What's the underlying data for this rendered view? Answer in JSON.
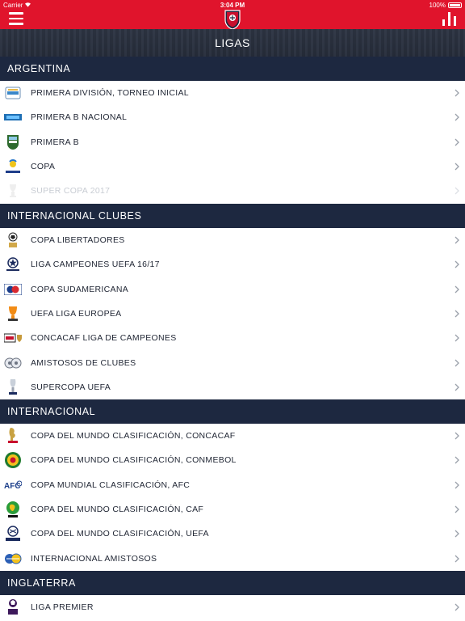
{
  "status_bar": {
    "carrier": "Carrier",
    "time": "3:04 PM",
    "battery": "100%"
  },
  "header": {
    "title": "LIGAS"
  },
  "sections": [
    {
      "title": "ARGENTINA",
      "items": [
        {
          "label": "PRIMERA DIVISIÓN, TORNEO INICIAL",
          "icon": "primera-division-logo-icon",
          "enabled": true
        },
        {
          "label": "PRIMERA B NACIONAL",
          "icon": "primera-b-nacional-logo-icon",
          "enabled": true
        },
        {
          "label": "PRIMERA B",
          "icon": "afa-crest-icon",
          "enabled": true
        },
        {
          "label": "COPA",
          "icon": "copa-argentina-logo-icon",
          "enabled": true
        },
        {
          "label": "SUPER COPA 2017",
          "icon": "super-copa-logo-icon",
          "enabled": false
        }
      ]
    },
    {
      "title": "INTERNACIONAL CLUBES",
      "items": [
        {
          "label": "COPA LIBERTADORES",
          "icon": "copa-libertadores-logo-icon",
          "enabled": true
        },
        {
          "label": "LIGA CAMPEONES UEFA 16/17",
          "icon": "champions-league-logo-icon",
          "enabled": true
        },
        {
          "label": "COPA SUDAMERICANA",
          "icon": "copa-sudamericana-logo-icon",
          "enabled": true
        },
        {
          "label": "UEFA LIGA EUROPEA",
          "icon": "europa-league-logo-icon",
          "enabled": true
        },
        {
          "label": "CONCACAF LIGA DE CAMPEONES",
          "icon": "concacaf-champions-logo-icon",
          "enabled": true
        },
        {
          "label": "AMISTOSOS DE CLUBES",
          "icon": "club-friendlies-logo-icon",
          "enabled": true
        },
        {
          "label": "SUPERCOPA UEFA",
          "icon": "uefa-supercup-logo-icon",
          "enabled": true
        }
      ]
    },
    {
      "title": "INTERNACIONAL",
      "items": [
        {
          "label": "COPA DEL MUNDO CLASIFICACIÓN, CONCACAF",
          "icon": "world-cup-logo-icon",
          "enabled": true
        },
        {
          "label": "COPA DEL MUNDO CLASIFICACIÓN, CONMEBOL",
          "icon": "conmebol-logo-icon",
          "enabled": true
        },
        {
          "label": "COPA MUNDIAL CLASIFICACIÓN, AFC",
          "icon": "afc-logo-icon",
          "enabled": true
        },
        {
          "label": "COPA DEL MUNDO CLASIFICACIÓN, CAF",
          "icon": "caf-logo-icon",
          "enabled": true
        },
        {
          "label": "COPA DEL MUNDO CLASIFICACIÓN, UEFA",
          "icon": "european-qualifiers-logo-icon",
          "enabled": true
        },
        {
          "label": "INTERNACIONAL AMISTOSOS",
          "icon": "international-friendlies-logo-icon",
          "enabled": true
        }
      ]
    },
    {
      "title": "INGLATERRA",
      "items": [
        {
          "label": "LIGA PREMIER",
          "icon": "premier-league-logo-icon",
          "enabled": true
        }
      ]
    }
  ],
  "colors": {
    "header_red": "#e0142c",
    "section_navy": "#1d2840",
    "text": "#1f2533",
    "disabled_text": "#c8ccd3",
    "chevron": "#9aa0aa"
  }
}
